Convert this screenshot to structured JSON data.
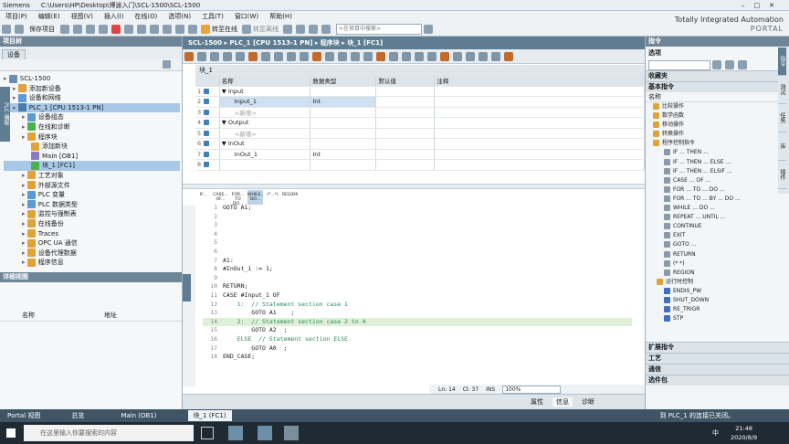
{
  "window": {
    "app": "Siemens",
    "path": "C:\\Users\\HP\\Desktop\\博途入门\\SCL-1500\\SCL-1500",
    "brand_line1": "Totally Integrated Automation",
    "brand_line2": "PORTAL"
  },
  "menu": [
    "项目(P)",
    "编辑(E)",
    "视图(V)",
    "插入(I)",
    "在线(O)",
    "选项(N)",
    "工具(T)",
    "窗口(W)",
    "帮助(H)"
  ],
  "toolbar": {
    "save_label": "保存项目",
    "go_online": "转至在线",
    "go_offline": "转至离线",
    "search_placeholder": "<在项目中搜索>"
  },
  "left_panel": {
    "title": "项目树",
    "tab": "设备",
    "tree": [
      {
        "label": "SCL-1500",
        "indent": 0,
        "color": "#6a8fb3"
      },
      {
        "label": "添加新设备",
        "indent": 1,
        "color": "#e2a23a"
      },
      {
        "label": "设备和网络",
        "indent": 1,
        "color": "#5b9bd5"
      },
      {
        "label": "PLC_1 [CPU 1513-1 PN]",
        "indent": 1,
        "color": "#4a7ba6",
        "selected": true
      },
      {
        "label": "设备组态",
        "indent": 2,
        "color": "#5b9bd5"
      },
      {
        "label": "在线和诊断",
        "indent": 2,
        "color": "#4caf50"
      },
      {
        "label": "程序块",
        "indent": 2,
        "color": "#e2a23a"
      },
      {
        "label": "添加新块",
        "indent": 3,
        "color": "#e2a23a"
      },
      {
        "label": "Main [OB1]",
        "indent": 3,
        "color": "#8a7bc9"
      },
      {
        "label": "块_1 [FC1]",
        "indent": 3,
        "color": "#4caf50",
        "selected": true
      },
      {
        "label": "工艺对象",
        "indent": 2,
        "color": "#e2a23a"
      },
      {
        "label": "外部源文件",
        "indent": 2,
        "color": "#e2a23a"
      },
      {
        "label": "PLC 变量",
        "indent": 2,
        "color": "#5b9bd5"
      },
      {
        "label": "PLC 数据类型",
        "indent": 2,
        "color": "#5b9bd5"
      },
      {
        "label": "监控与强制表",
        "indent": 2,
        "color": "#e2a23a"
      },
      {
        "label": "在线备份",
        "indent": 2,
        "color": "#e2a23a"
      },
      {
        "label": "Traces",
        "indent": 2,
        "color": "#e2a23a"
      },
      {
        "label": "OPC UA 通信",
        "indent": 2,
        "color": "#e2a23a"
      },
      {
        "label": "设备代理数据",
        "indent": 2,
        "color": "#e2a23a"
      },
      {
        "label": "程序信息",
        "indent": 2,
        "color": "#e2a23a"
      }
    ],
    "detail_title": "详细视图",
    "detail_cols": [
      "名称",
      "地址"
    ],
    "side_tab": "PLC 编程"
  },
  "editor": {
    "breadcrumb": "SCL-1500 ▸ PLC_1 [CPU 1513-1 PN] ▸ 程序块 ▸ 块_1 [FC1]",
    "block_title": "块_1",
    "columns": [
      "名称",
      "数据类型",
      "默认值",
      "注释"
    ],
    "rows": [
      {
        "no": "1",
        "name": "▼ Input",
        "type": "",
        "indent": 0
      },
      {
        "no": "2",
        "name": "Input_1",
        "type": "Int",
        "indent": 1,
        "active": true
      },
      {
        "no": "3",
        "name": "<新增>",
        "type": "",
        "indent": 1,
        "grey": true
      },
      {
        "no": "4",
        "name": "▼ Output",
        "type": "",
        "indent": 0
      },
      {
        "no": "5",
        "name": "<新增>",
        "type": "",
        "indent": 1,
        "grey": true
      },
      {
        "no": "6",
        "name": "▼ InOut",
        "type": "",
        "indent": 0
      },
      {
        "no": "7",
        "name": "InOut_1",
        "type": "Int",
        "indent": 1
      },
      {
        "no": "8",
        "name": "",
        "type": "",
        "indent": 0
      }
    ],
    "snippets": [
      "IF...",
      "CASE... OF...",
      "FOR... TO DO...",
      "WHILE... DO...",
      "(*...*)",
      "REGION"
    ],
    "code": [
      {
        "n": "1",
        "t": "GOTO A1;"
      },
      {
        "n": "2",
        "t": ""
      },
      {
        "n": "3",
        "t": ""
      },
      {
        "n": "4",
        "t": ""
      },
      {
        "n": "5",
        "t": ""
      },
      {
        "n": "6",
        "t": ""
      },
      {
        "n": "7",
        "t": "A1:"
      },
      {
        "n": "8",
        "t": "#InOut_1 := 1;"
      },
      {
        "n": "9",
        "t": ""
      },
      {
        "n": "10",
        "t": "RETURN;"
      },
      {
        "n": "11",
        "t": "CASE #Input_1 OF"
      },
      {
        "n": "12",
        "t": "    1:  // Statement section case 1"
      },
      {
        "n": "13",
        "t": "        GOTO A1    ;"
      },
      {
        "n": "14",
        "t": "    2:  // Statement section case 2 to 4",
        "hl": true
      },
      {
        "n": "15",
        "t": "        GOTO A2  ;"
      },
      {
        "n": "16",
        "t": "    ELSE  // Statement section ELSE"
      },
      {
        "n": "17",
        "t": "        GOTO A0  ;"
      },
      {
        "n": "18",
        "t": "END_CASE;"
      }
    ],
    "status": {
      "ln": "Ln: 14",
      "cl": "Cl: 37",
      "ins": "INS",
      "zoom": "100%"
    },
    "bottom_tabs": [
      "属性",
      "信息",
      "诊断"
    ]
  },
  "right_panel": {
    "title": "指令",
    "options_label": "选项",
    "favorites": "收藏夹",
    "basic": "基本指令",
    "name_col": "名称",
    "groups": [
      "比较操作",
      "数学函数",
      "移动操作",
      "转换操作",
      "程序控制指令"
    ],
    "items": [
      "IF ... THEN ...",
      "IF ... THEN ... ELSE ...",
      "IF ... THEN ... ELSIF ...",
      "CASE ... OF ...",
      "FOR ... TO ... DO ...",
      "FOR ... TO ... BY ... DO ...",
      "WHILE ... DO ...",
      "REPEAT ... UNTIL ...",
      "CONTINUE",
      "EXIT",
      "GOTO ...",
      "RETURN",
      "(* *)",
      "REGION"
    ],
    "runtime_group": "运行时控制",
    "runtime_items": [
      "ENDIS_PW",
      "SHUT_DOWN",
      "RE_TRIGR",
      "STP"
    ],
    "ext": "扩展指令",
    "tech": "工艺",
    "comm": "通信",
    "opt": "选件包",
    "side_tabs": [
      "指令",
      "测试",
      "任务",
      "库",
      "插件"
    ]
  },
  "portal_bar": {
    "portal": "Portal 视图",
    "items": [
      "总览",
      "Main (OB1)",
      "块_1 (FC1)"
    ],
    "status": "到 PLC_1 的连接已关闭。"
  },
  "taskbar": {
    "search": "在这里输入你要搜索的内容",
    "time": "21:48",
    "date": "2020/8/9",
    "ime": "中"
  }
}
